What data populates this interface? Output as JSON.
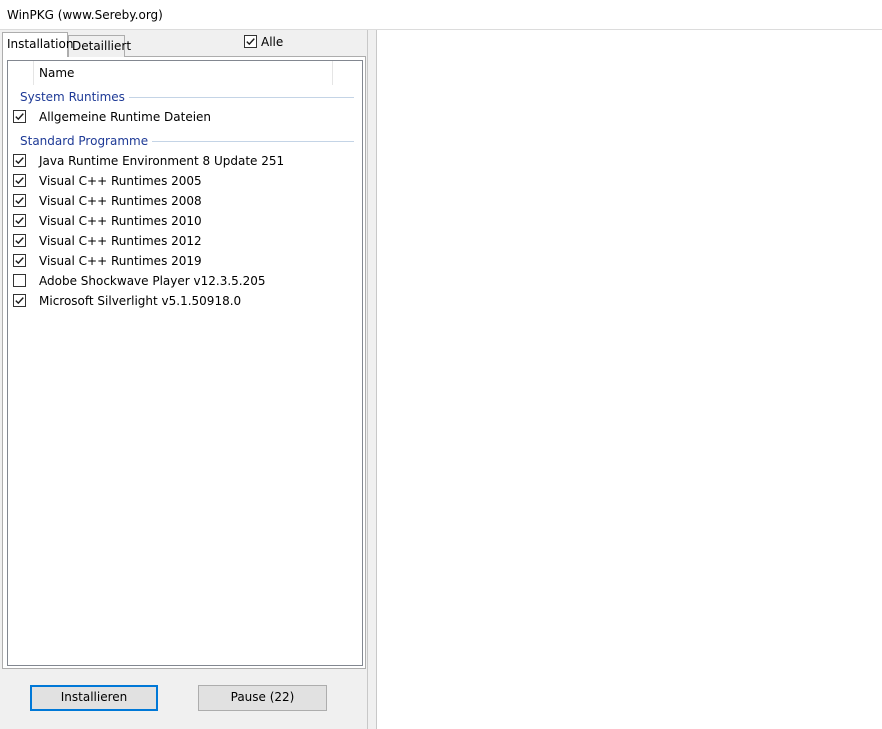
{
  "window": {
    "title": "WinPKG (www.Sereby.org)"
  },
  "tabs": [
    {
      "label": "Installation",
      "active": true
    },
    {
      "label": "Detailliert",
      "active": false
    }
  ],
  "select_all": {
    "label": "Alle",
    "checked": true
  },
  "list": {
    "column_header": "Name",
    "groups": [
      {
        "label": "System Runtimes",
        "items": [
          {
            "label": "Allgemeine Runtime Dateien",
            "checked": true
          }
        ]
      },
      {
        "label": "Standard Programme",
        "items": [
          {
            "label": "Java Runtime Environment 8 Update 251",
            "checked": true
          },
          {
            "label": "Visual C++ Runtimes 2005",
            "checked": true
          },
          {
            "label": "Visual C++ Runtimes 2008",
            "checked": true
          },
          {
            "label": "Visual C++ Runtimes 2010",
            "checked": true
          },
          {
            "label": "Visual C++ Runtimes 2012",
            "checked": true
          },
          {
            "label": "Visual C++ Runtimes 2019",
            "checked": true
          },
          {
            "label": "Adobe Shockwave Player v12.3.5.205",
            "checked": false
          },
          {
            "label": "Microsoft Silverlight v5.1.50918.0",
            "checked": true
          }
        ]
      }
    ]
  },
  "buttons": {
    "install": "Installieren",
    "pause": "Pause (22)"
  },
  "colors": {
    "group_header": "#1e3a96",
    "default_button_border": "#0078d7",
    "panel_background": "#f0f0f0"
  },
  "icons": {
    "checkbox_checked": "checkmark-icon"
  }
}
